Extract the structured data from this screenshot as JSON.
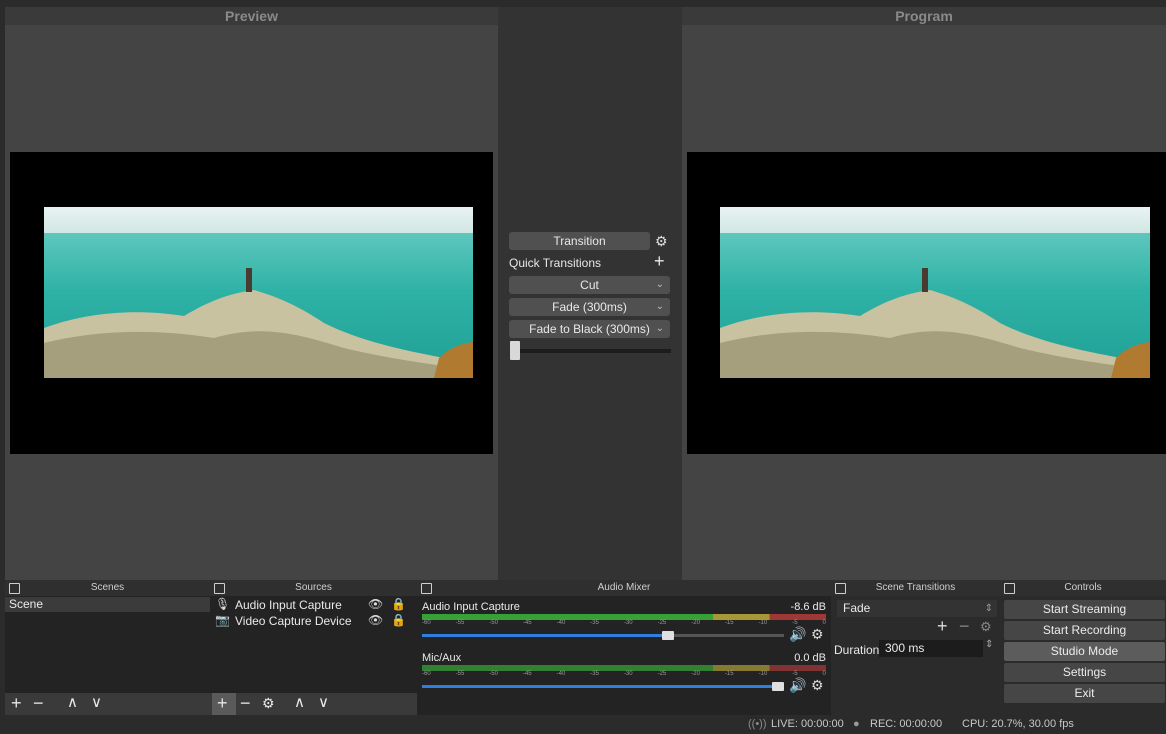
{
  "preview": {
    "title": "Preview"
  },
  "program": {
    "title": "Program"
  },
  "transition_panel": {
    "transition_label": "Transition",
    "quick_transitions_label": "Quick Transitions",
    "items": [
      "Cut",
      "Fade (300ms)",
      "Fade to Black (300ms)"
    ]
  },
  "scenes": {
    "title": "Scenes",
    "items": [
      "Scene"
    ]
  },
  "sources": {
    "title": "Sources",
    "items": [
      "Audio Input Capture",
      "Video Capture Device"
    ]
  },
  "audio_mixer": {
    "title": "Audio Mixer",
    "channels": [
      {
        "name": "Audio Input Capture",
        "level": "-8.6 dB",
        "volume": 0.68
      },
      {
        "name": "Mic/Aux",
        "level": "0.0 dB",
        "volume": 1.0
      }
    ],
    "scale_ticks": [
      "-60",
      "-55",
      "-50",
      "-45",
      "-40",
      "-35",
      "-30",
      "-25",
      "-20",
      "-15",
      "-10",
      "-5",
      "0"
    ]
  },
  "scene_transitions": {
    "title": "Scene Transitions",
    "selected": "Fade",
    "duration_label": "Duration",
    "duration_value": "300 ms"
  },
  "controls": {
    "title": "Controls",
    "buttons": [
      "Start Streaming",
      "Start Recording",
      "Studio Mode",
      "Settings",
      "Exit"
    ]
  },
  "status": {
    "live": "LIVE: 00:00:00",
    "rec": "REC: 00:00:00",
    "cpu": "CPU: 20.7%, 30.00 fps"
  },
  "colors": {
    "volume_bar": "#2f7fe0",
    "meter_green": "#3cbf3c",
    "meter_yellow": "#c8b43a",
    "meter_red": "#c03c3c",
    "studio_mode_active": "#5a5a5a"
  }
}
